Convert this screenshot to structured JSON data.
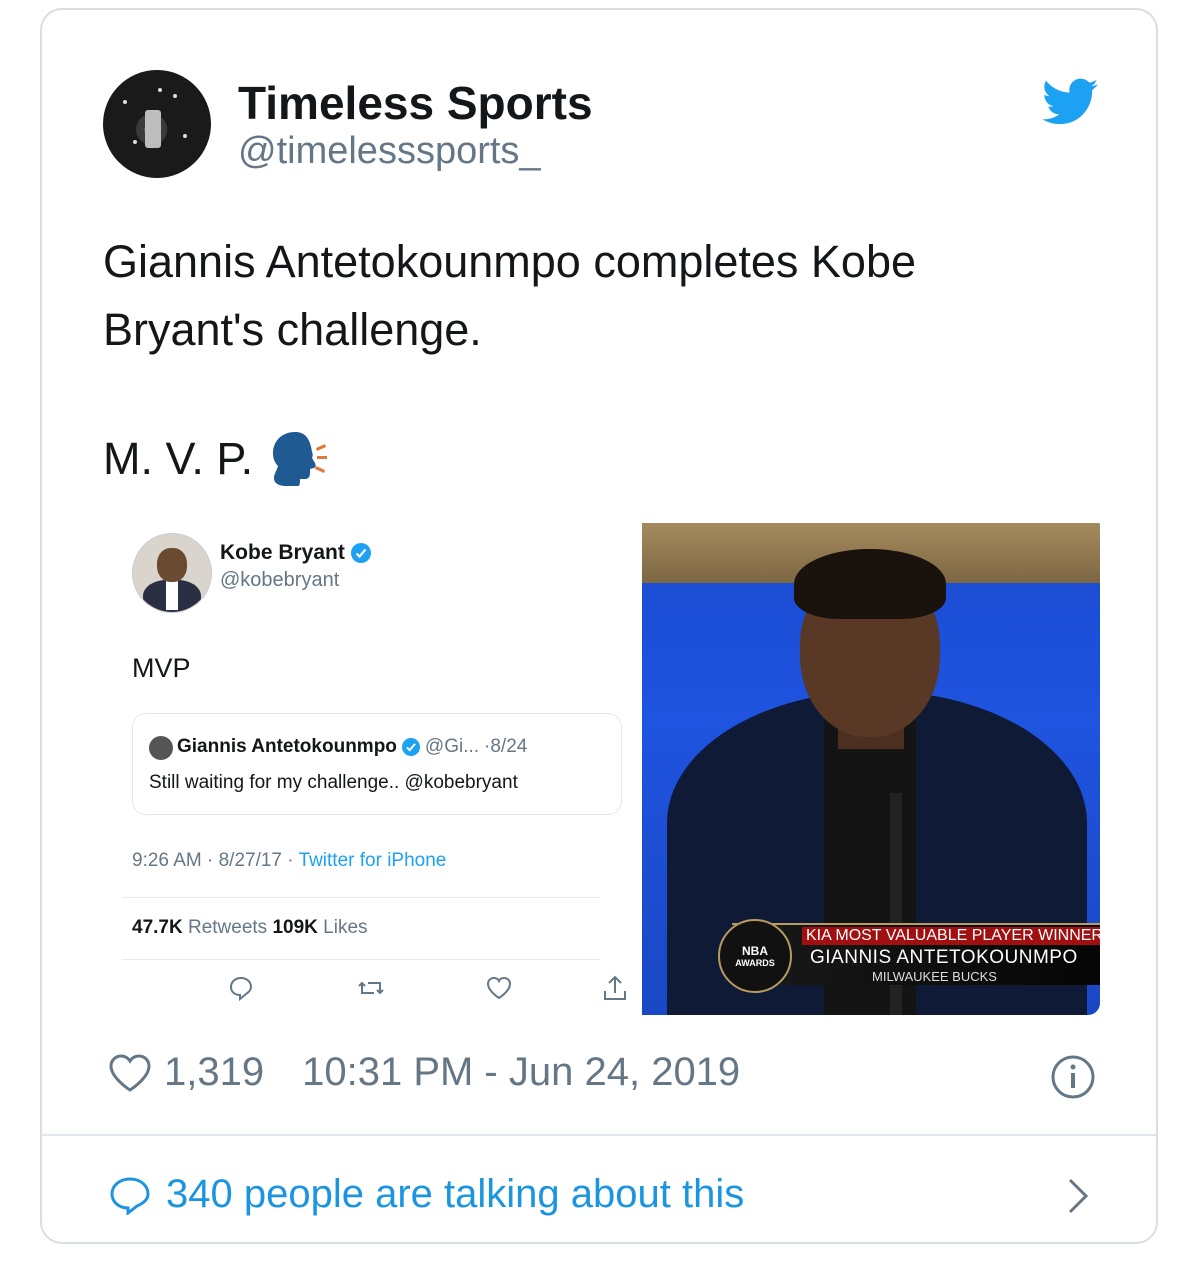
{
  "tweet": {
    "display_name": "Timeless Sports",
    "handle": "@timelesssports_",
    "text": "Giannis Antetokounmpo completes Kobe Bryant's challenge.",
    "mvp_line": "M. V. P.",
    "likes": "1,319",
    "timestamp": "10:31 PM - Jun 24, 2019",
    "talking": "340 people are talking about this"
  },
  "embedded": {
    "name": "Kobe Bryant",
    "handle": "@kobebryant",
    "text": "MVP",
    "quote": {
      "name": "Giannis Antetokounmpo",
      "handle": "@Gi...",
      "date": "·8/24",
      "text": "Still waiting for my challenge.. @kobebryant"
    },
    "meta_time": "9:26 AM · 8/27/17 · ",
    "meta_source": "Twitter for iPhone",
    "retweets": "47.7K",
    "retweets_label": "Retweets",
    "likes": "109K",
    "likes_label": "Likes"
  },
  "broadcast": {
    "sponsor": "KIA",
    "award": "MOST VALUABLE PLAYER WINNER",
    "player": "GIANNIS ANTETOKOUNMPO",
    "team": "MILWAUKEE BUCKS",
    "badge_top": "NBA",
    "badge_bottom": "AWARDS"
  },
  "icons": {
    "brand": "twitter-bird-icon",
    "speaking_head": "speaking-head-icon",
    "heart": "heart-icon",
    "info": "info-icon",
    "comment": "speech-bubble-icon",
    "chevron": "chevron-right-icon"
  },
  "colors": {
    "twitter_blue": "#1da1f2",
    "link_blue": "#1b95e0",
    "muted": "#657786",
    "text": "#14171a"
  }
}
